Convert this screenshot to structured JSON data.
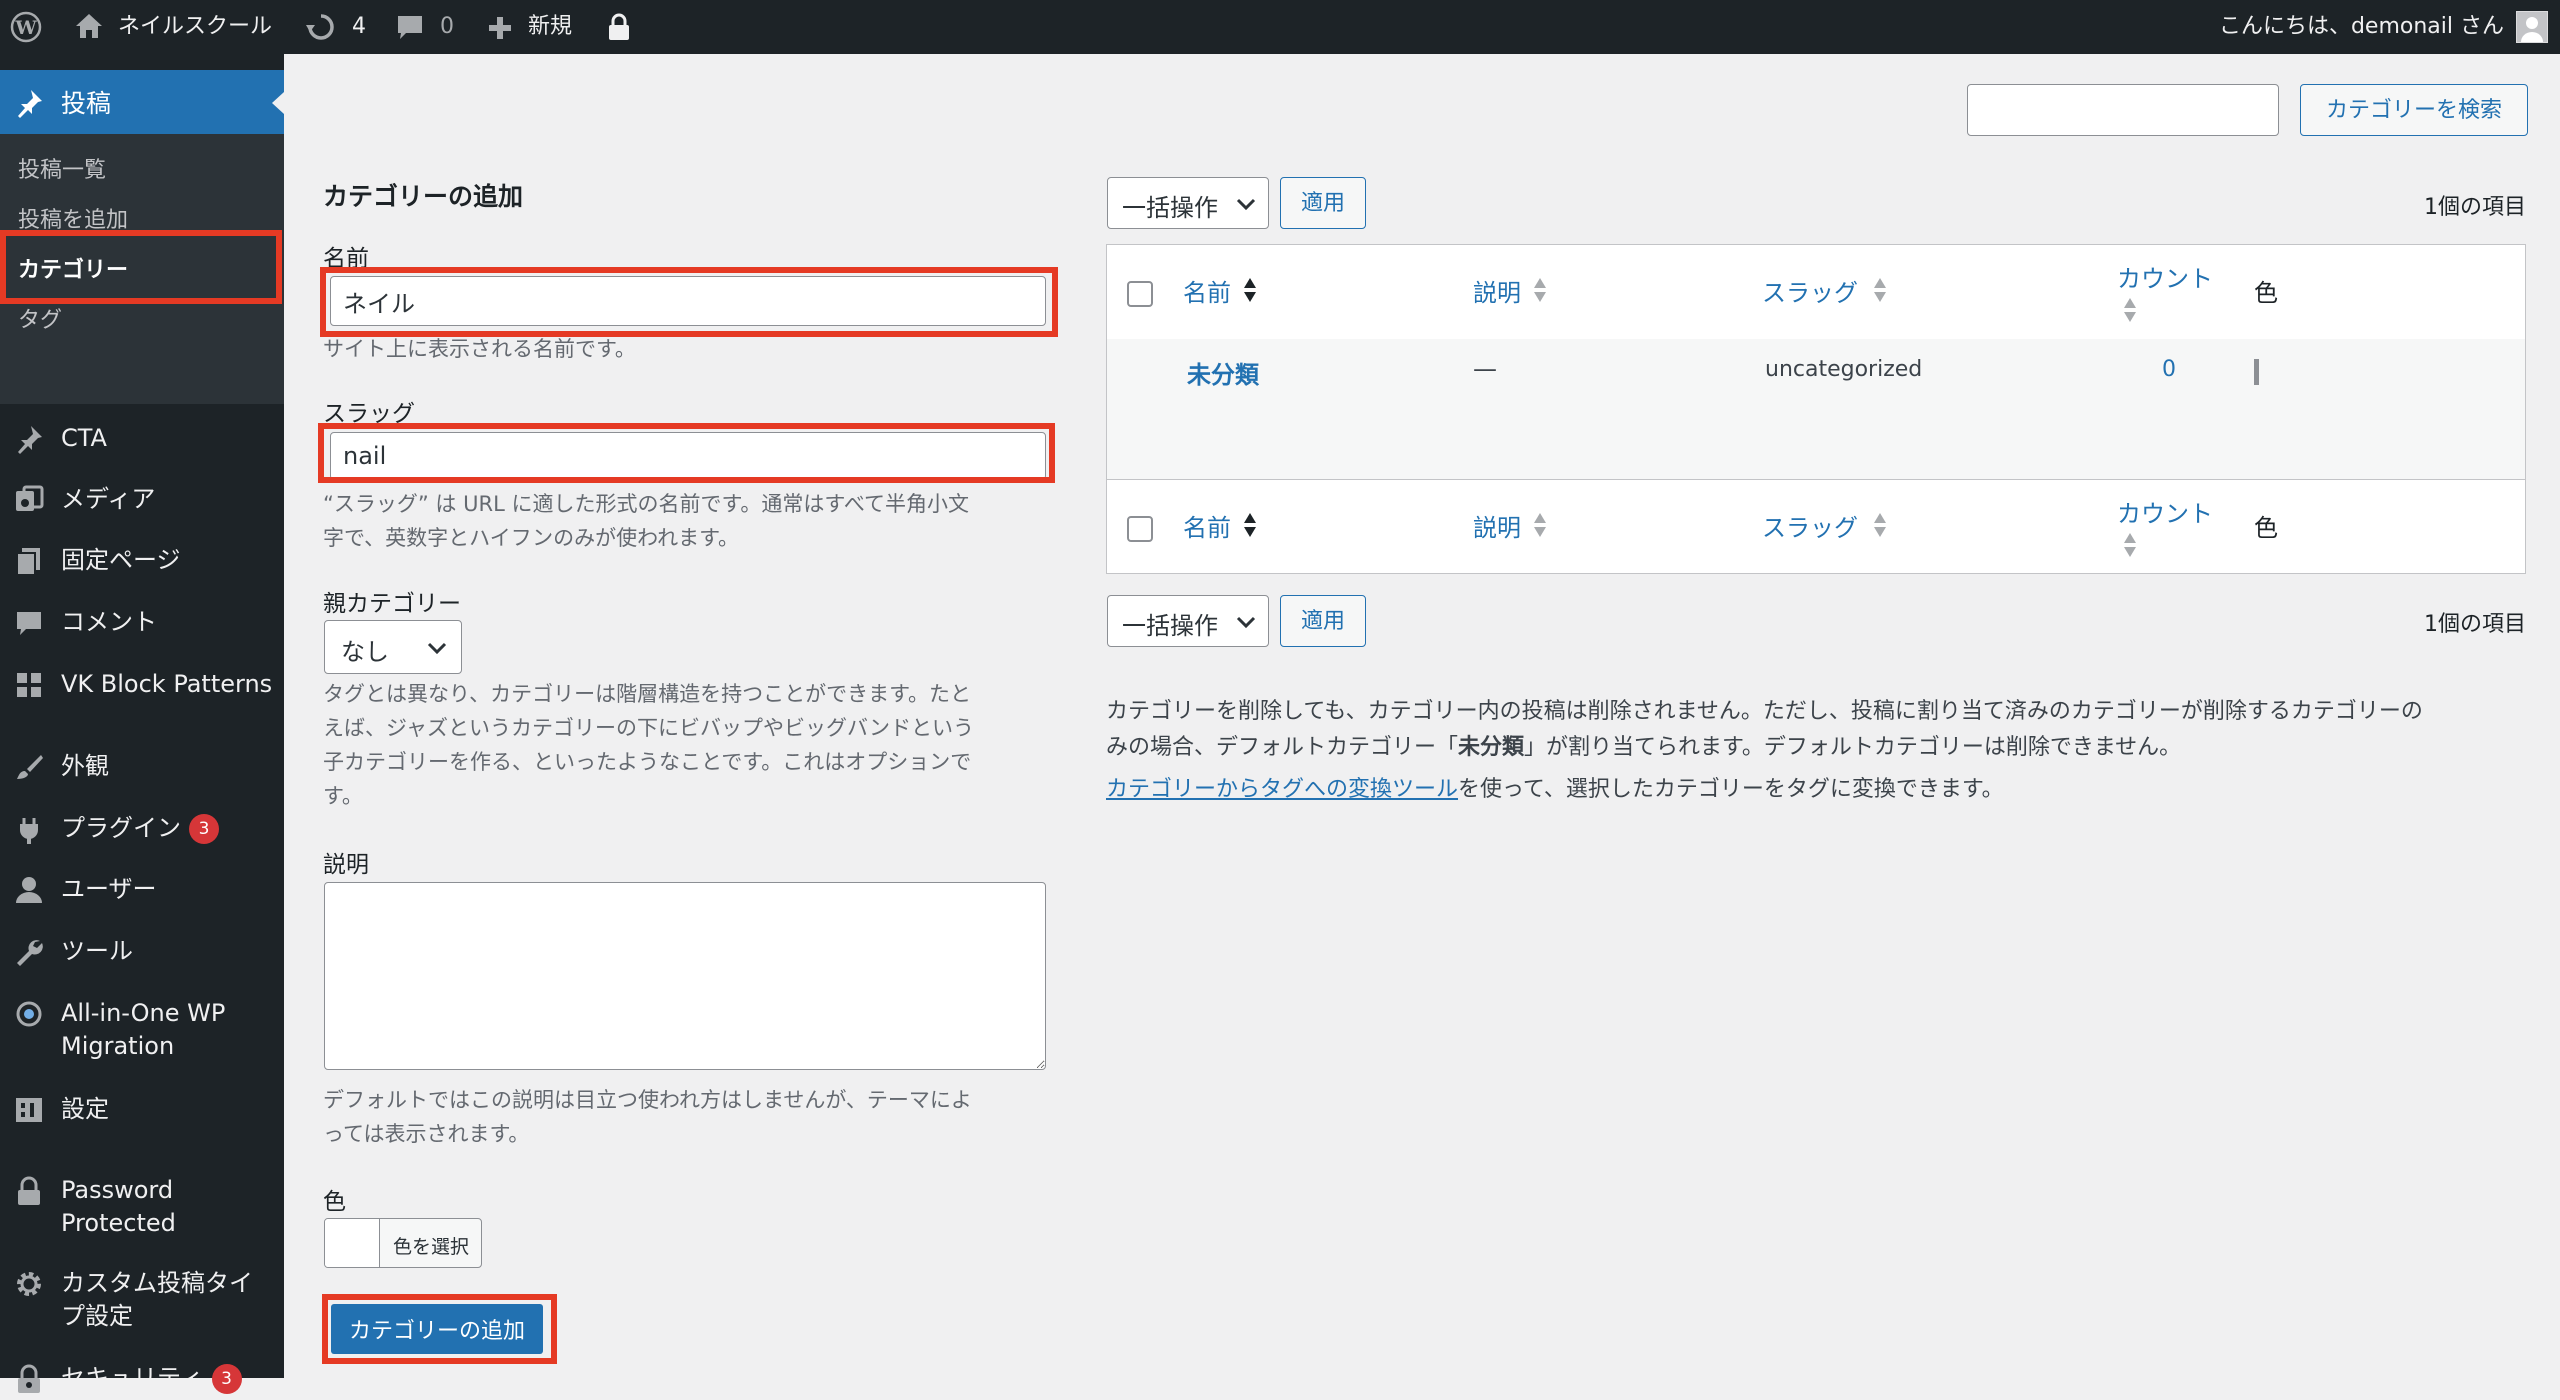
{
  "adminbar": {
    "site_name": "ネイルスクール",
    "updates_count": "4",
    "comments_count": "0",
    "new_label": "新規",
    "greeting": "こんにちは、demonail さん"
  },
  "sidebar": {
    "posts_label": "投稿",
    "submenu": [
      "投稿一覧",
      "投稿を追加",
      "カテゴリー",
      "タグ"
    ],
    "items": [
      {
        "label": "CTA",
        "icon": "pin-icon"
      },
      {
        "label": "メディア",
        "icon": "media-icon"
      },
      {
        "label": "固定ページ",
        "icon": "pages-icon"
      },
      {
        "label": "コメント",
        "icon": "comment-icon"
      },
      {
        "label": "VK Block Patterns",
        "icon": "grid-icon"
      },
      {
        "label": "外観",
        "icon": "brush-icon"
      },
      {
        "label": "プラグイン",
        "icon": "plugin-icon",
        "badge": "3"
      },
      {
        "label": "ユーザー",
        "icon": "user-icon"
      },
      {
        "label": "ツール",
        "icon": "wrench-icon"
      },
      {
        "label": "All-in-One WP",
        "label2": "Migration",
        "icon": "migration-icon"
      },
      {
        "label": "設定",
        "icon": "settings-icon"
      },
      {
        "label": "Password",
        "label2": "Protected",
        "icon": "lock-icon"
      },
      {
        "label": "カスタム投稿タイ",
        "label2": "プ設定",
        "icon": "gear-icon"
      },
      {
        "label": "セキュリティ",
        "icon": "security-icon",
        "badge": "3"
      }
    ]
  },
  "search": {
    "button_label": "カテゴリーを検索",
    "value": ""
  },
  "form": {
    "heading": "カテゴリーの追加",
    "name_label": "名前",
    "name_value": "ネイル",
    "name_help": "サイト上に表示される名前です。",
    "slug_label": "スラッグ",
    "slug_value": "nail",
    "slug_help_1": "“スラッグ” は URL に適した形式の名前です。通常はすべて半角小文",
    "slug_help_2": "字で、英数字とハイフンのみが使われます。",
    "parent_label": "親カテゴリー",
    "parent_value": "なし",
    "parent_help_1": "タグとは異なり、カテゴリーは階層構造を持つことができます。たと",
    "parent_help_2": "えば、ジャズというカテゴリーの下にビバップやビッグバンドという",
    "parent_help_3": "子カテゴリーを作る、といったようなことです。これはオプションで",
    "parent_help_4": "す。",
    "desc_label": "説明",
    "desc_value": "",
    "desc_help_1": "デフォルトではこの説明は目立つ使われ方はしませんが、テーマによ",
    "desc_help_2": "っては表示されます。",
    "color_label": "色",
    "color_button": "色を選択",
    "submit_label": "カテゴリーの追加"
  },
  "list": {
    "bulk_label": "一括操作",
    "apply_label": "適用",
    "item_count": "1個の項目",
    "columns": {
      "name": "名前",
      "description": "説明",
      "slug": "スラッグ",
      "count": "カウント",
      "color": "色"
    },
    "rows": [
      {
        "name": "未分類",
        "description": "—",
        "slug": "uncategorized",
        "count": "0"
      }
    ]
  },
  "notes": {
    "line1": "カテゴリーを削除しても、カテゴリー内の投稿は削除されません。ただし、投稿に割り当て済みのカテゴリーが削除するカテゴリーの",
    "line2_a": "みの場合、デフォルトカテゴリー「",
    "line2_b": "未分類",
    "line2_c": "」が割り当てられます。デフォルトカテゴリーは削除できません。",
    "link": "カテゴリーからタグへの変換ツール",
    "line3_rest": "を使って、選択したカテゴリーをタグに変換できます。"
  }
}
